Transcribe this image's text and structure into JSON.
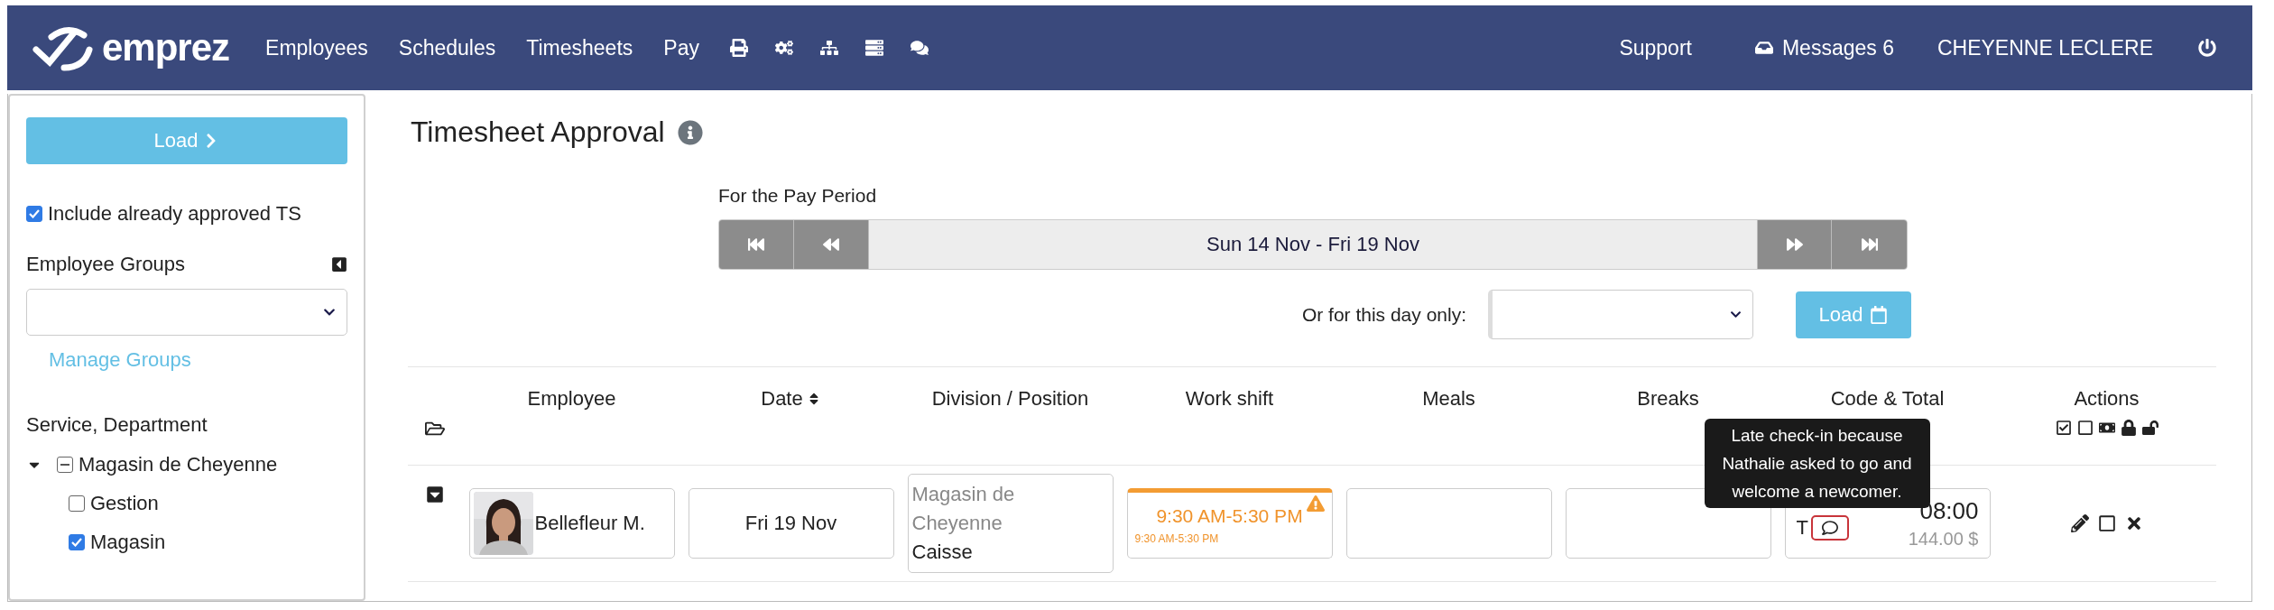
{
  "nav": {
    "logo": "emprez",
    "items": [
      "Employees",
      "Schedules",
      "Timesheets",
      "Pay"
    ],
    "support": "Support",
    "messages": "Messages 6",
    "user": "CHEYENNE LECLERE"
  },
  "sidebar": {
    "load_button": "Load",
    "include_approved": {
      "label": "Include already approved TS",
      "checked": true
    },
    "employee_groups": {
      "label": "Employee Groups"
    },
    "manage_groups": "Manage Groups",
    "departments": {
      "label": "Service, Department",
      "tree": [
        {
          "label": "Magasin de Cheyenne",
          "expanded": true,
          "indeterminate": true,
          "children": [
            {
              "label": "Gestion",
              "checked": false
            },
            {
              "label": "Magasin",
              "checked": true
            }
          ]
        }
      ]
    }
  },
  "page": {
    "title": "Timesheet Approval",
    "pay_period": {
      "label": "For the Pay Period",
      "range": "Sun 14 Nov - Fri 19 Nov"
    },
    "day_only": {
      "label": "Or for this day only:",
      "load_button": "Load"
    }
  },
  "table": {
    "columns": [
      {
        "label": "Employee",
        "sortable": false
      },
      {
        "label": "Date",
        "sortable": true
      },
      {
        "label": "Division / Position",
        "sortable": false
      },
      {
        "label": "Work shift",
        "sortable": false
      },
      {
        "label": "Meals",
        "sortable": false
      },
      {
        "label": "Breaks",
        "sortable": false
      },
      {
        "label": "Code & Total",
        "sortable": false
      },
      {
        "label": "Actions",
        "sortable": false
      }
    ],
    "rows": [
      {
        "expanded": false,
        "employee": "Bellefleur M.",
        "date": "Fri 19 Nov",
        "division": "Magasin de Cheyenne",
        "position": "Caisse",
        "shift": {
          "planned": "9:30 AM-5:30 PM",
          "actual": "9:30 AM-5:30 PM",
          "warning": true
        },
        "code": "T",
        "has_comment": true,
        "total": "08:00",
        "amount": "144.00 $",
        "approved": false,
        "comment_tooltip": "Late check-in because Nathalie asked to go and welcome a newcomer."
      }
    ]
  }
}
